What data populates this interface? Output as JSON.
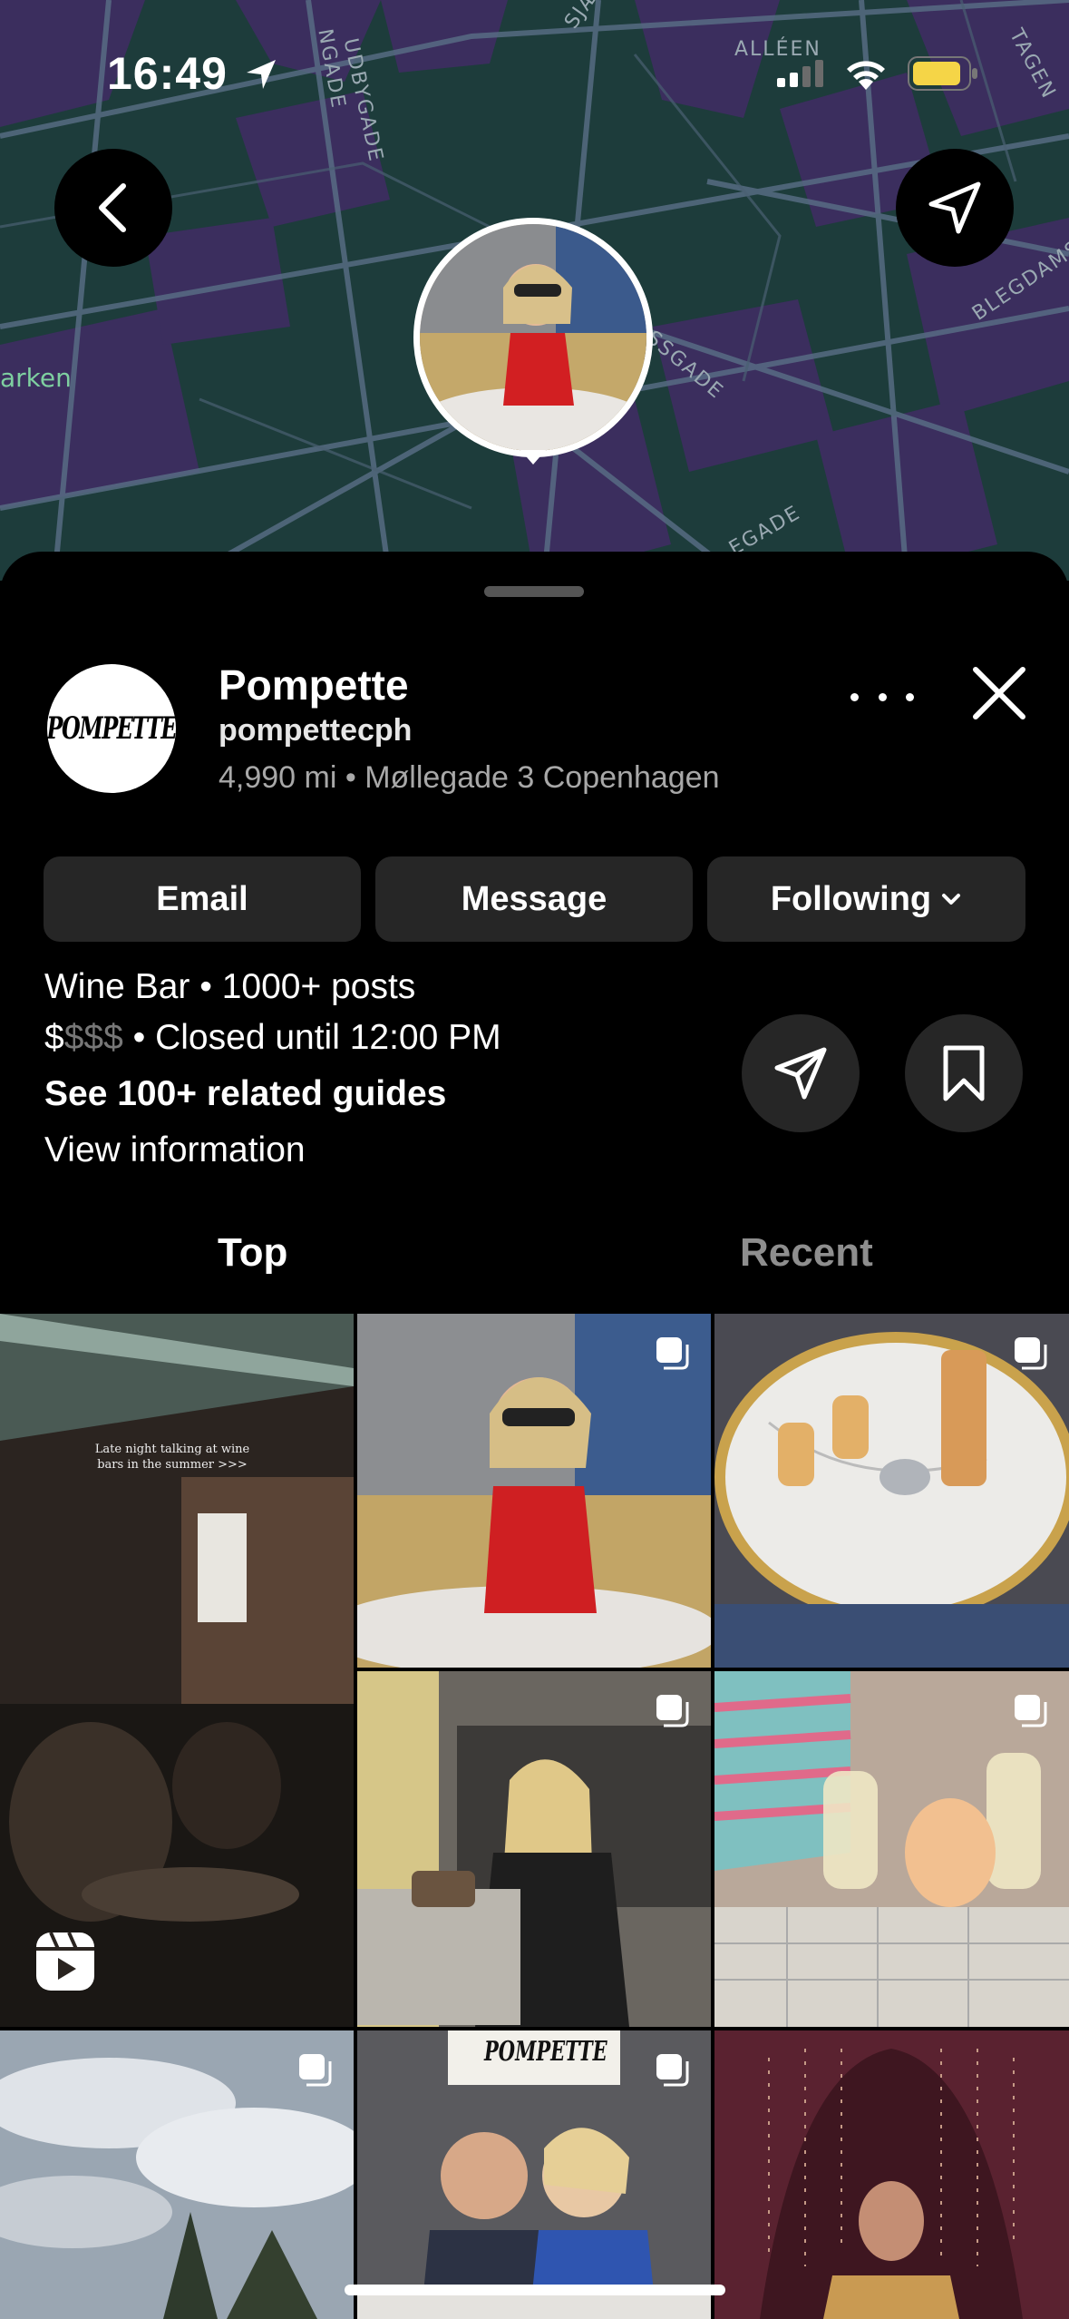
{
  "status": {
    "time": "16:49"
  },
  "map": {
    "labels": [
      "ALLÉEN",
      "UDBYGADE",
      "TAGEN",
      "BLEGDAMSV",
      "SSGADE",
      "arken",
      "SJÆ",
      "EGADE",
      "NGADE"
    ]
  },
  "place": {
    "avatar_text": "POMPETTE",
    "name": "Pompette",
    "username": "pompettecph",
    "distance": "4,990 mi • Møllegade 3 Copenhagen"
  },
  "buttons": {
    "email": "Email",
    "message": "Message",
    "following": "Following"
  },
  "info": {
    "category": "Wine Bar • 1000+ posts",
    "price_filled": "$",
    "price_empty": "$$$",
    "hours": " • Closed until 12:00 PM",
    "guides": "See 100+ related guides",
    "view_info": "View information"
  },
  "tabs": {
    "top": "Top",
    "recent": "Recent"
  },
  "posts": {
    "reel_caption": "Late night talking at wine bars in the summer >>>",
    "sign_text": "POMPETTE"
  },
  "colors": {
    "accent": "#ffffff",
    "pill_bg": "#262626",
    "map_green": "#1f3a3a",
    "map_purple": "#3a2f5c"
  }
}
